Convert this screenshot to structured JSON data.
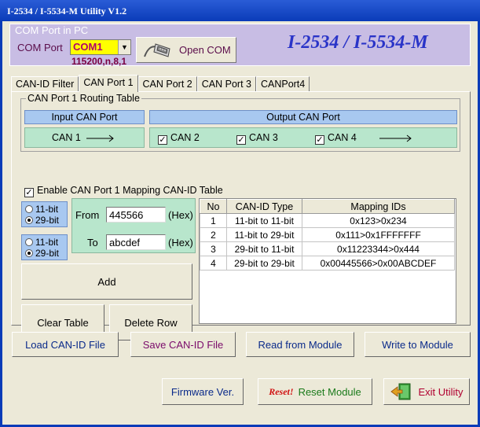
{
  "window": {
    "title": "I-2534 / I-5534-M Utility V1.2"
  },
  "com": {
    "legend": "COM Port in PC",
    "label": "COM Port",
    "selected": "COM1",
    "baud": "115200,n,8,1",
    "open_label": "Open COM",
    "product_title": "I-2534 / I-5534-M"
  },
  "tabs": [
    {
      "label": "CAN-ID Filter"
    },
    {
      "label": "CAN Port 1"
    },
    {
      "label": "CAN Port 2"
    },
    {
      "label": "CAN Port 3"
    },
    {
      "label": "CANPort4"
    }
  ],
  "routing": {
    "legend": "CAN Port 1 Routing Table",
    "input_header": "Input CAN Port",
    "output_header": "Output CAN Port",
    "input_port": "CAN 1",
    "outputs": [
      {
        "label": "CAN 2",
        "checked": true
      },
      {
        "label": "CAN 3",
        "checked": true
      },
      {
        "label": "CAN 4",
        "checked": true
      }
    ]
  },
  "mapping": {
    "enable_label": "Enable CAN Port 1 Mapping CAN-ID Table",
    "from_bits": {
      "opt1": "11-bit",
      "opt2": "29-bit",
      "selected": "29-bit"
    },
    "to_bits": {
      "opt1": "11-bit",
      "opt2": "29-bit",
      "selected": "29-bit"
    },
    "from_label": "From",
    "from_value": "445566",
    "to_label": "To",
    "to_value": "abcdef",
    "hex_label": "(Hex)",
    "add_label": "Add",
    "clear_label": "Clear Table",
    "delete_label": "Delete Row"
  },
  "table": {
    "headers": [
      "No",
      "CAN-ID Type",
      "Mapping IDs"
    ],
    "rows": [
      [
        "1",
        "11-bit to 11-bit",
        "0x123>0x234"
      ],
      [
        "2",
        "11-bit to 29-bit",
        "0x111>0x1FFFFFFF"
      ],
      [
        "3",
        "29-bit to 11-bit",
        "0x11223344>0x444"
      ],
      [
        "4",
        "29-bit to 29-bit",
        "0x00445566>0x00ABCDEF"
      ]
    ]
  },
  "file_buttons": {
    "load": "Load CAN-ID File",
    "save": "Save CAN-ID File",
    "read": "Read from Module",
    "write": "Write to Module"
  },
  "bottom_buttons": {
    "firmware": "Firmware Ver.",
    "reset_badge": "Reset!",
    "reset": "Reset Module",
    "exit": "Exit Utility"
  },
  "colors": {
    "title_bar": "#0a3bb8",
    "com_panel": "#c8bde4",
    "header_blue": "#a8c8f0",
    "row_green": "#b8e6cc",
    "select_yellow": "#ffff00"
  }
}
